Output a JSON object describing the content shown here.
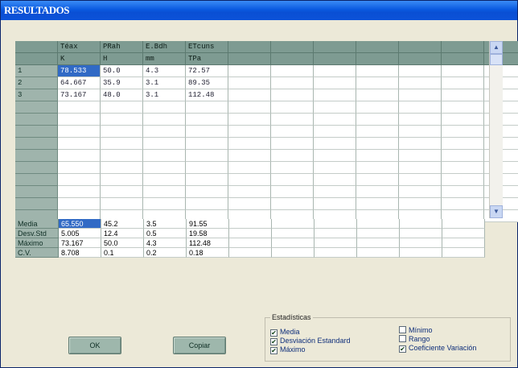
{
  "window": {
    "title": "RESULTADOS"
  },
  "table": {
    "columns": [
      {
        "name": "Téax",
        "unit": "K"
      },
      {
        "name": "PRah",
        "unit": "H"
      },
      {
        "name": "E.Bdh",
        "unit": "mm"
      },
      {
        "name": "ETcuns",
        "unit": "TPa"
      },
      {
        "name": "",
        "unit": ""
      },
      {
        "name": "",
        "unit": ""
      },
      {
        "name": "",
        "unit": ""
      },
      {
        "name": "",
        "unit": ""
      },
      {
        "name": "",
        "unit": ""
      },
      {
        "name": "",
        "unit": ""
      },
      {
        "name": "",
        "unit": ""
      }
    ],
    "rows": [
      {
        "index": "1",
        "cells": [
          "78.533",
          "50.0",
          "4.3",
          "72.57"
        ]
      },
      {
        "index": "2",
        "cells": [
          "64.667",
          "35.9",
          "3.1",
          "89.35"
        ]
      },
      {
        "index": "3",
        "cells": [
          "73.167",
          "48.0",
          "3.1",
          "112.48"
        ]
      }
    ]
  },
  "stats": {
    "rows": [
      {
        "label": "Media",
        "cells": [
          "65.550",
          "45.2",
          "3.5",
          "91.55"
        ]
      },
      {
        "label": "Desv.Std",
        "cells": [
          "5.005",
          "12.4",
          "0.5",
          "19.58"
        ]
      },
      {
        "label": "Máximo",
        "cells": [
          "73.167",
          "50.0",
          "4.3",
          "112.48"
        ]
      },
      {
        "label": "C.V.",
        "cells": [
          "8.708",
          "0.1",
          "0.2",
          "0.18"
        ]
      }
    ]
  },
  "buttons": {
    "ok": "OK",
    "copy": "Copiar"
  },
  "estadisticas": {
    "title": "Estadísticas",
    "left": [
      {
        "label": "Media",
        "checked": true
      },
      {
        "label": "Desviación Estandard",
        "checked": true
      },
      {
        "label": "Máximo",
        "checked": true
      }
    ],
    "right": [
      {
        "label": "Mínimo",
        "checked": false
      },
      {
        "label": "Rango",
        "checked": false
      },
      {
        "label": "Coeficiente Variación",
        "checked": true
      }
    ]
  },
  "icons": {
    "scroll_up": "scroll-up-arrow-icon",
    "scroll_down": "scroll-down-arrow-icon",
    "checkmark": "checkmark-icon"
  },
  "colors": {
    "title_bar": "#0a5ae0",
    "header": "#7e9b92",
    "selection": "#316ac5",
    "button": "#9eb7ac"
  }
}
